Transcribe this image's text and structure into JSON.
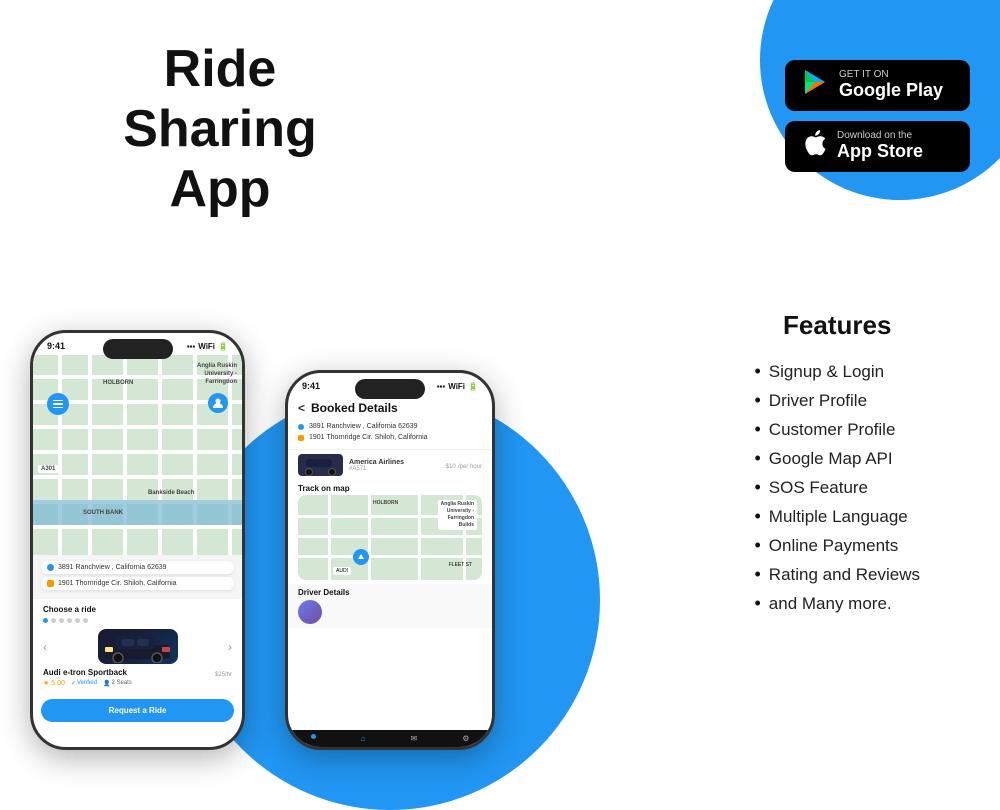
{
  "page": {
    "title": "Ride Sharing App",
    "title_line1": "Ride Sharing",
    "title_line2": "App"
  },
  "store_buttons": {
    "google_play": {
      "small_text": "GET IT ON",
      "large_text": "Google Play"
    },
    "app_store": {
      "small_text": "Download on the",
      "large_text": "App Store"
    }
  },
  "features": {
    "title": "Features",
    "items": [
      "Signup & Login",
      "Driver Profile",
      "Customer Profile",
      "Google Map API",
      "SOS Feature",
      "Multiple Language",
      "Online Payments",
      "Rating and Reviews",
      "and Many more."
    ]
  },
  "phone1": {
    "status_time": "9:41",
    "origin": "3891 Ranchview , California 62639",
    "destination": "1901 Thornridge Cir. Shiloh, California",
    "choose_ride_label": "Choose a ride",
    "car_name": "Audi e-tron Sportback",
    "car_rating": "5.00",
    "car_verified": "Verified",
    "car_seats": "2 Seats",
    "car_price": "$25",
    "car_price_unit": "/hr",
    "request_btn": "Request a Ride",
    "map_labels": {
      "holborn": "HOLBORN",
      "south_bank": "SOUTH BANK",
      "bankside": "Bankside Beach",
      "a301": "A301",
      "anglia": "Anglia Ruskin\nUniversity -\nFarringdon"
    }
  },
  "phone2": {
    "status_time": "9:41",
    "header": "Booked Details",
    "back_label": "<",
    "origin": "3891 Ranchview , California 62639",
    "destination": "1901 Thornridge Cir. Shiloh, California",
    "car_name": "America Airlines",
    "car_id": "#A571",
    "car_price": "$10",
    "car_price_unit": "/per hour",
    "track_label": "Track on map",
    "driver_label": "Driver Details"
  },
  "colors": {
    "primary_blue": "#2196F3",
    "dark": "#111111",
    "white": "#ffffff",
    "map_green": "#d4e6d4",
    "map_water": "#7ab8d4"
  }
}
